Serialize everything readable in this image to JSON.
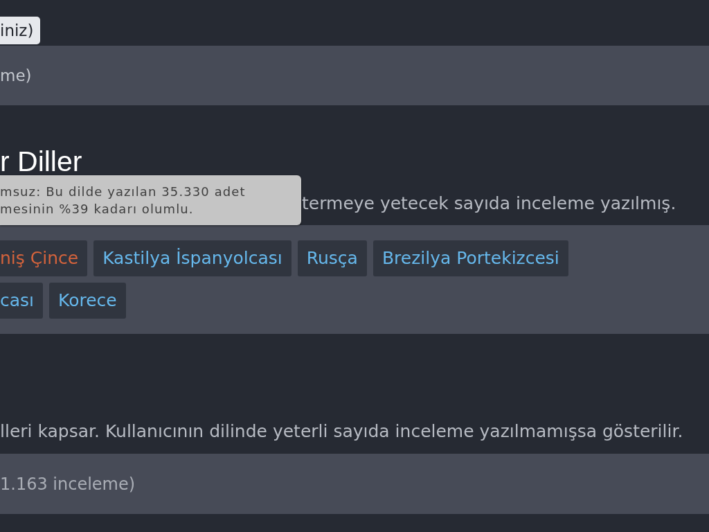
{
  "top_button": {
    "label": "iniz)"
  },
  "summary_bar": {
    "text": "me)"
  },
  "languages_section": {
    "title": "r Diller",
    "tooltip": {
      "text": "msuz: Bu dilde yazılan 35.330 adet\nmesinin %39 kadarı olumlu."
    },
    "description": "termeye yetecek sayıda inceleme yazılmış.",
    "tag_rows": [
      [
        {
          "label": "niş Çince",
          "color": "#d4633c"
        },
        {
          "label": "Kastilya İspanyolcası",
          "color": "#66b8ec"
        },
        {
          "label": "Rusça",
          "color": "#66b8ec"
        },
        {
          "label": "Brezilya Portekizcesi",
          "color": "#66b8ec"
        }
      ],
      [
        {
          "label": "cası",
          "color": "#66b8ec"
        },
        {
          "label": "Korece",
          "color": "#66b8ec"
        }
      ]
    ]
  },
  "other_section": {
    "description": "lleri kapsar. Kullanıcının dilinde yeterli sayıda inceleme yazılmamışsa gösterilir.",
    "summary_text": "1.163 inceleme)"
  }
}
